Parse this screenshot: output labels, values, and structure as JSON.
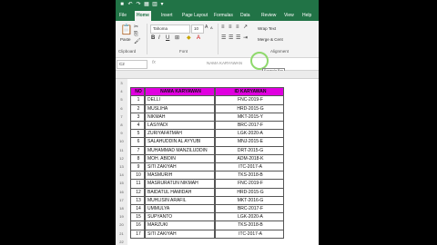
{
  "titlebar": {
    "icons": [
      "save-icon",
      "undo-icon",
      "redo-icon",
      "table-icon",
      "chart-icon",
      "customize-icon"
    ]
  },
  "tabs": [
    "File",
    "Home",
    "Insert",
    "Page Layout",
    "Formulas",
    "Data",
    "Review",
    "View",
    "Help"
  ],
  "active_tab": "Home",
  "ribbon": {
    "paste": "Paste",
    "clipboard": "Clipboard",
    "font_name": "Tahoma",
    "font_size": "10",
    "bold": "B",
    "italic": "I",
    "underline": "U",
    "font_group": "Font",
    "wrap_text": "Wrap Text",
    "merge_center": "Merge & Cent",
    "alignment_group": "Alignment"
  },
  "formula_bar": {
    "namebox": "C2",
    "fx": "fx",
    "content": "NAMA KARYAWAN",
    "tooltip": "Formula Bar"
  },
  "table": {
    "headers": [
      "NO",
      "NAMA KARYAWAN",
      "ID KARYAWAN"
    ],
    "rows": [
      {
        "no": "1",
        "name": "DELLI",
        "id": "FNC-2019-F"
      },
      {
        "no": "2",
        "name": "MUSLIHA",
        "id": "HRD-2015-G"
      },
      {
        "no": "3",
        "name": "NIKMAH",
        "id": "MKT-2015-Y"
      },
      {
        "no": "4",
        "name": "LASIYADI",
        "id": "BRC-2017-F"
      },
      {
        "no": "5",
        "name": "ZURIYAFATMAH",
        "id": "LGK-2020-A"
      },
      {
        "no": "6",
        "name": "SALAHUDDIN AL AYYUBI",
        "id": "MNJ-2015-E"
      },
      {
        "no": "7",
        "name": "MUHAMMAD MANZILUDDIN",
        "id": "DRT-2015-G"
      },
      {
        "no": "8",
        "name": "MOH. ABIDIN",
        "id": "ADM-2018-K"
      },
      {
        "no": "9",
        "name": "SITI ZAKIYAH",
        "id": "ITC-2017-A"
      },
      {
        "no": "10",
        "name": "MASMURIH",
        "id": "TKS-2018-B"
      },
      {
        "no": "11",
        "name": "MASRURATUN NIKMAH",
        "id": "FNC-2019-F"
      },
      {
        "no": "12",
        "name": "BAIDATUL HAMIDAH",
        "id": "HRD-2015-G"
      },
      {
        "no": "13",
        "name": "MUHLISIN ARAFIL",
        "id": "MKT-2016-G"
      },
      {
        "no": "14",
        "name": "UMMULYA",
        "id": "BRC-2017-F"
      },
      {
        "no": "15",
        "name": "SUPYANTO",
        "id": "LGK-2020-A"
      },
      {
        "no": "16",
        "name": "MARZUKI",
        "id": "TKS-2018-B"
      },
      {
        "no": "17",
        "name": "SITI ZAKIYAH",
        "id": "ITC-2017-A"
      }
    ]
  },
  "row_numbers": [
    "3",
    "4",
    "5",
    "6",
    "7",
    "8",
    "9",
    "10",
    "11",
    "12",
    "13",
    "14",
    "15",
    "16",
    "17",
    "18",
    "19",
    "20",
    "21",
    "22"
  ],
  "colors": {
    "excel_green": "#217346",
    "header_magenta": "#e000e0",
    "cursor_ring": "#8fd96c"
  }
}
